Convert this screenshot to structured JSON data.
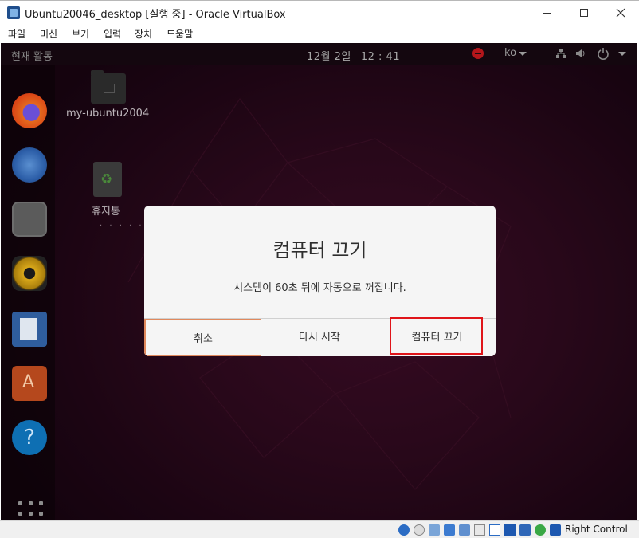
{
  "window": {
    "title": "Ubuntu20046_desktop [실행 중] - Oracle VirtualBox",
    "controls": {
      "minimize": "–",
      "maximize": "☐",
      "close": "✕"
    }
  },
  "menubar": [
    "파일",
    "머신",
    "보기",
    "입력",
    "장치",
    "도움말"
  ],
  "guest": {
    "topbar": {
      "activities": "현재 활동",
      "clock_date": "12월 2일",
      "clock_time": "12 : 41",
      "input_language": "ko"
    },
    "dock_apps": [
      "firefox-icon",
      "thunderbird-icon",
      "files-icon",
      "rhythmbox-icon",
      "writer-icon",
      "software-icon",
      "help-icon",
      "show-apps-icon"
    ],
    "desktop_icons": [
      {
        "label": "my-ubuntu2004",
        "icon": "home-folder-icon"
      },
      {
        "label": "휴지통",
        "icon": "trash-icon"
      }
    ],
    "dialog": {
      "title": "컴퓨터 끄기",
      "message": "시스템이 60초 뒤에 자동으로 꺼집니다.",
      "buttons": {
        "cancel": "취소",
        "restart": "다시 시작",
        "power_off": "컴퓨터 끄기"
      }
    }
  },
  "statusbar": {
    "host_key": "Right Control",
    "icons": [
      "hard-disk-icon",
      "optical-drive-icon",
      "audio-icon",
      "network-icon",
      "usb-icon",
      "shared-folders-icon",
      "display-icon",
      "recording-icon",
      "cpu-icon",
      "virtualization-icon",
      "mouse-integration-icon",
      "keyboard-icon"
    ]
  },
  "colors": {
    "highlight_red": "#e0151a",
    "cancel_focus": "#e0895d",
    "desktop_wallpaper": "#3a0d24"
  }
}
